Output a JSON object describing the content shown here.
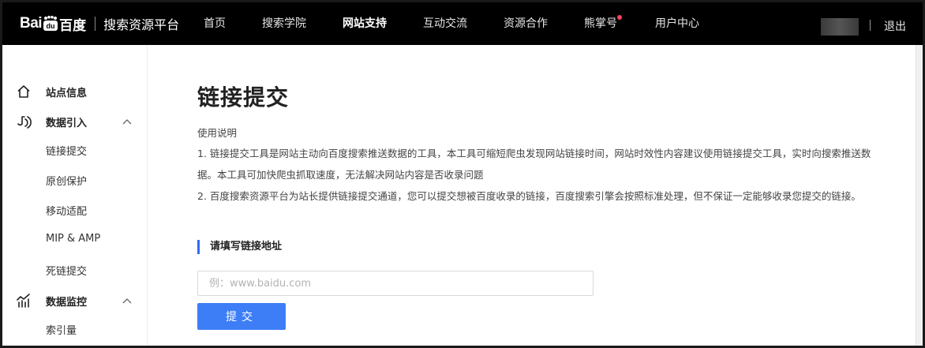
{
  "header": {
    "logo_bai": "Bai",
    "logo_brand": "百度",
    "platform": "搜索资源平台",
    "nav": [
      {
        "label": "首页"
      },
      {
        "label": "搜索学院"
      },
      {
        "label": "网站支持"
      },
      {
        "label": "互动交流"
      },
      {
        "label": "资源合作"
      },
      {
        "label": "熊掌号"
      },
      {
        "label": "用户中心"
      }
    ],
    "active_nav": "网站支持",
    "logout": "退出",
    "badge_color": "#f5455a"
  },
  "sidebar": {
    "groups": [
      {
        "label": "站点信息",
        "icon": "home-icon"
      },
      {
        "label": "数据引入",
        "icon": "data-import-icon",
        "expanded": true
      },
      {
        "label": "数据监控",
        "icon": "chart-monitor-icon",
        "expanded": true
      }
    ],
    "items": [
      {
        "label": "链接提交"
      },
      {
        "label": "原创保护"
      },
      {
        "label": "移动适配"
      },
      {
        "label": "MIP & AMP"
      },
      {
        "label": "死链提交"
      },
      {
        "label": "索引量"
      }
    ]
  },
  "main": {
    "title": "链接提交",
    "desc_heading": "使用说明",
    "desc_lines": [
      "1. 链接提交工具是网站主动向百度搜索推送数据的工具，本工具可缩短爬虫发现网站链接时间，网站时效性内容建议使用链接提交工具，实时向搜索推送数",
      "据。本工具可加快爬虫抓取速度，无法解决网站内容是否收录问题",
      "2. 百度搜索资源平台为站长提供链接提交通道，您可以提交想被百度收录的链接，百度搜索引擎会按照标准处理，但不保证一定能够收录您提交的链接。"
    ],
    "form_label": "请填写链接地址",
    "input_placeholder": "例：www.baidu.com",
    "input_value": "",
    "submit_label": "提交",
    "accent_color": "#3d7ef7"
  }
}
